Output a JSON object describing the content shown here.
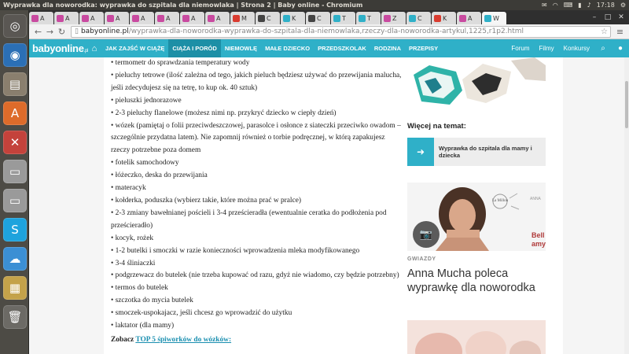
{
  "os": {
    "window_title": "Wyprawka dla noworodka: wyprawka do szpitala dla niemowlaka | Strona 2 | Baby online - Chromium",
    "clock": "17:18"
  },
  "launcher": {
    "items": [
      {
        "icon": "ubuntu-logo-icon",
        "glyph": "◎",
        "color": "#5a5753"
      },
      {
        "icon": "chromium-icon",
        "glyph": "◉",
        "color": "#2b6fb5"
      },
      {
        "icon": "files-icon",
        "glyph": "▤",
        "color": "#8a7f6e"
      },
      {
        "icon": "software-center-icon",
        "glyph": "A",
        "color": "#dd6b2a"
      },
      {
        "icon": "settings-icon",
        "glyph": "✕",
        "color": "#c4423b"
      },
      {
        "icon": "drive-icon",
        "glyph": "▭",
        "color": "#9a9a9a"
      },
      {
        "icon": "drive-icon-2",
        "glyph": "▭",
        "color": "#9a9a9a"
      },
      {
        "icon": "skype-icon",
        "glyph": "S",
        "color": "#1ea3dd"
      },
      {
        "icon": "cloud-icon",
        "glyph": "☁",
        "color": "#3b8fd4"
      },
      {
        "icon": "image-viewer-icon",
        "glyph": "▦",
        "color": "#c4a24a"
      },
      {
        "icon": "trash-icon",
        "glyph": "🗑",
        "color": "#6c6a65"
      }
    ]
  },
  "tabs": [
    {
      "label": "A",
      "color": "#c94aa0"
    },
    {
      "label": "A",
      "color": "#c94aa0"
    },
    {
      "label": "A",
      "color": "#c94aa0"
    },
    {
      "label": "A",
      "color": "#c94aa0"
    },
    {
      "label": "A",
      "color": "#c94aa0"
    },
    {
      "label": "A",
      "color": "#c94aa0"
    },
    {
      "label": "A",
      "color": "#c94aa0"
    },
    {
      "label": "A",
      "color": "#c94aa0"
    },
    {
      "label": "M",
      "color": "#d93b2f"
    },
    {
      "label": "C",
      "color": "#444444"
    },
    {
      "label": "K",
      "color": "#2fb0c8"
    },
    {
      "label": "C",
      "color": "#444444"
    },
    {
      "label": "T",
      "color": "#2fb0c8"
    },
    {
      "label": "T",
      "color": "#2fb0c8"
    },
    {
      "label": "Z",
      "color": "#c94aa0"
    },
    {
      "label": "C",
      "color": "#2fb0c8"
    },
    {
      "label": "K",
      "color": "#d93b2f"
    },
    {
      "label": "A",
      "color": "#c94aa0"
    },
    {
      "label": "W",
      "color": "#2fb0c8",
      "active": true
    }
  ],
  "address": {
    "host": "babyonline.pl",
    "path": "/wyprawka-dla-noworodka-wyprawka-do-szpitala-dla-niemowlaka,rzeczy-dla-noworodka-artykul,1225,r1p2.html"
  },
  "nav": {
    "logo": "babyonline",
    "logo_suffix": ".pl",
    "items": [
      {
        "label": "JAK ZAJŚĆ W CIĄŻĘ",
        "active": false
      },
      {
        "label": "CIĄŻA I PORÓD",
        "active": true
      },
      {
        "label": "NIEMOWLĘ",
        "active": false
      },
      {
        "label": "MAŁE DZIECKO",
        "active": false
      },
      {
        "label": "PRZEDSZKOLAK",
        "active": false
      },
      {
        "label": "RODZINA",
        "active": false
      },
      {
        "label": "PRZEPISY",
        "active": false
      }
    ],
    "right": [
      "Forum",
      "Filmy",
      "Konkursy"
    ]
  },
  "article": {
    "items": [
      "• termometr do sprawdzania temperatury wody",
      "• pieluchy tetrowe (ilość zależna od tego, jakich pieluch będziesz używać do przewijania malucha, jeśli zdecydujesz się na tetrę, to kup ok. 40 sztuk)",
      "• pieluszki jednorazowe",
      "• 2-3 pieluchy flanelowe (możesz nimi np. przykryć dziecko w ciepły dzień)",
      "• wózek (pamiętaj o folii przeciwdeszczowej, parasolce i osłonce z siateczki przeciwko owadom – szczególnie przydatna latem). Nie zapomnij również o torbie podręcznej, w którą zapakujesz rzeczy potrzebne poza domem",
      "• fotelik samochodowy",
      "• łóżeczko, deska do przewijania",
      "• materacyk",
      "• kołderka, poduszka (wybierz takie, które można prać w pralce)",
      "• 2-3 zmiany bawełnianej pościeli i 3-4 prześcieradła (ewentualnie ceratka do podłożenia pod prześcieradło)",
      "• kocyk, rożek",
      "• 1-2 butelki i smoczki w razie konieczności wprowadzenia mleka modyfikowanego",
      "• 3-4 śliniaczki",
      "• podgrzewacz do butelek (nie trzeba kupować od razu, gdyż nie wiadomo, czy będzie potrzebny)",
      "• termos do butelek",
      "• szczotka do mycia butelek",
      "• smoczek-uspokajacz, jeśli chcesz go wprowadzić do użytku",
      "• laktator (dla mamy)"
    ],
    "see_also_prefix": "Zobacz",
    "see_also_link": "TOP 5 śpiworków do wózków:"
  },
  "sidebar": {
    "more_title": "Więcej na temat:",
    "related_title": "Wyprawka do szpitala dla mamy i dziecka",
    "category": "GWIAZDY",
    "headline": "Anna Mucha poleca wyprawkę dla noworodka",
    "photo_texts": [
      "La Millou",
      "ANNA",
      "Bell",
      "amy"
    ]
  }
}
